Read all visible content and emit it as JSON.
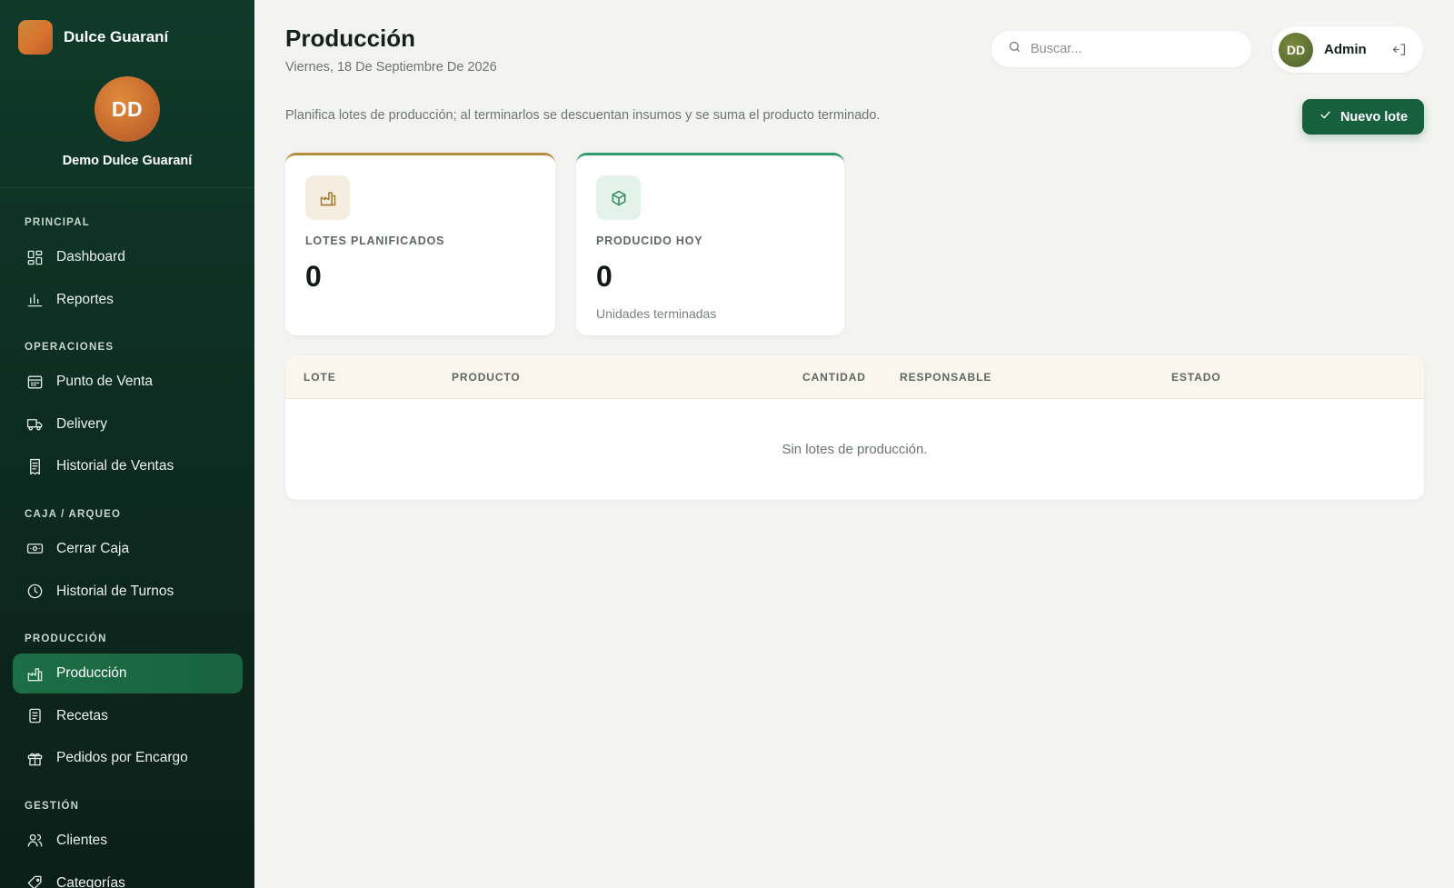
{
  "brand": {
    "name": "Dulce Guaraní"
  },
  "profile": {
    "initials": "DD",
    "name": "Demo Dulce Guaraní"
  },
  "sidebar": {
    "sections": [
      {
        "label": "PRINCIPAL",
        "items": [
          {
            "label": "Dashboard",
            "icon": "dashboard-icon"
          },
          {
            "label": "Reportes",
            "icon": "bar-chart-icon"
          }
        ]
      },
      {
        "label": "OPERACIONES",
        "items": [
          {
            "label": "Punto de Venta",
            "icon": "register-icon"
          },
          {
            "label": "Delivery",
            "icon": "truck-icon"
          },
          {
            "label": "Historial de Ventas",
            "icon": "receipt-icon"
          }
        ]
      },
      {
        "label": "CAJA / ARQUEO",
        "items": [
          {
            "label": "Cerrar Caja",
            "icon": "cash-icon"
          },
          {
            "label": "Historial de Turnos",
            "icon": "clock-icon"
          }
        ]
      },
      {
        "label": "PRODUCCIÓN",
        "items": [
          {
            "label": "Producción",
            "icon": "factory-icon",
            "active": true
          },
          {
            "label": "Recetas",
            "icon": "book-icon"
          },
          {
            "label": "Pedidos por Encargo",
            "icon": "gift-icon"
          }
        ]
      },
      {
        "label": "GESTIÓN",
        "items": [
          {
            "label": "Clientes",
            "icon": "users-icon"
          },
          {
            "label": "Categorías",
            "icon": "tag-icon"
          }
        ]
      }
    ]
  },
  "header": {
    "title": "Producción",
    "date": "Viernes, 18 De Septiembre De 2026",
    "search_placeholder": "Buscar...",
    "user": {
      "initials": "DD",
      "name": "Admin"
    }
  },
  "main": {
    "description": "Planifica lotes de producción; al terminarlos se descuentan insumos y se suma el producto terminado.",
    "new_button": "Nuevo lote",
    "cards": [
      {
        "label": "LOTES PLANIFICADOS",
        "value": "0",
        "sub": "",
        "icon": "factory-icon",
        "accent": "#b98d3f"
      },
      {
        "label": "PRODUCIDO HOY",
        "value": "0",
        "sub": "Unidades terminadas",
        "icon": "box-icon",
        "accent": "#2f9a6a"
      }
    ],
    "table": {
      "columns": [
        "LOTE",
        "PRODUCTO",
        "CANTIDAD",
        "RESPONSABLE",
        "ESTADO"
      ],
      "empty_text": "Sin lotes de producción."
    }
  },
  "colors": {
    "sidebar_bg": "#0f3a2a",
    "accent_green": "#16603d",
    "active_item": "#1c6e45"
  }
}
